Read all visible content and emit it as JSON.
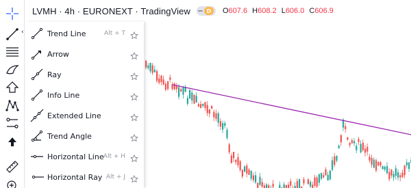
{
  "header": {
    "symbol_title": "LVMH · 4h · EURONEXT · TradingView",
    "badge_letter": "D",
    "ohlc": {
      "o_key": "O",
      "o_val": "607.6",
      "h_key": "H",
      "h_val": "608.2",
      "l_key": "L",
      "l_val": "606.0",
      "c_key": "C",
      "c_val": "606.9"
    }
  },
  "toolbar": {
    "tools": [
      {
        "name": "crosshair-icon"
      },
      {
        "name": "trend-line-icon"
      },
      {
        "name": "fib-retracement-icon"
      },
      {
        "name": "brush-icon"
      },
      {
        "name": "text-icon"
      },
      {
        "name": "pattern-icon"
      },
      {
        "name": "prediction-icon"
      },
      {
        "name": "arrow-up-icon"
      },
      {
        "name": "ruler-icon"
      },
      {
        "name": "zoom-in-icon"
      }
    ]
  },
  "menu": {
    "items": [
      {
        "label": "Trend Line",
        "hotkey": "Alt + T",
        "icon": "trend-line-icon"
      },
      {
        "label": "Arrow",
        "hotkey": "",
        "icon": "arrow-line-icon"
      },
      {
        "label": "Ray",
        "hotkey": "",
        "icon": "ray-icon"
      },
      {
        "label": "Info Line",
        "hotkey": "",
        "icon": "info-line-icon"
      },
      {
        "label": "Extended Line",
        "hotkey": "",
        "icon": "extended-line-icon"
      },
      {
        "label": "Trend Angle",
        "hotkey": "",
        "icon": "trend-angle-icon"
      },
      {
        "label": "Horizontal Line",
        "hotkey": "Alt + H",
        "icon": "horizontal-line-icon"
      },
      {
        "label": "Horizontal Ray",
        "hotkey": "Alt + J",
        "icon": "horizontal-ray-icon"
      }
    ]
  },
  "colors": {
    "up": "#26a69a",
    "down": "#ef5350",
    "trendline": "#9c27b0",
    "text": "#131722",
    "muted": "#9598a1"
  }
}
